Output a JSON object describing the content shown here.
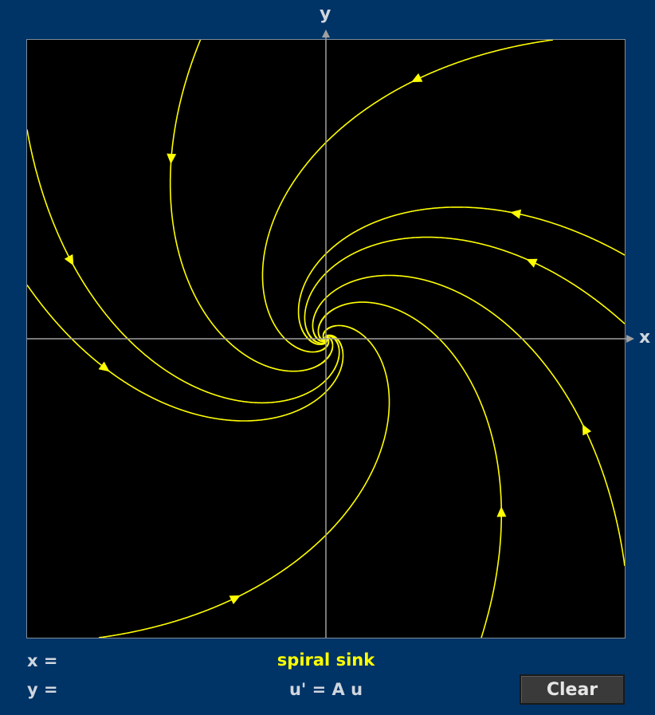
{
  "axes": {
    "x_label": "x",
    "y_label": "y"
  },
  "readouts": {
    "x": "x =",
    "y": "y ="
  },
  "system_type": "spiral sink",
  "equation": "u' = A u",
  "clear_label": "Clear",
  "colors": {
    "background": "#003366",
    "plot": "#000000",
    "trajectory": "#ffff00",
    "axis": "#a0a0a0"
  },
  "chart_data": {
    "type": "line",
    "title": "",
    "xlabel": "x",
    "ylabel": "y",
    "xlim": [
      -1,
      1
    ],
    "ylim": [
      -1,
      1
    ],
    "grid": false,
    "matrix_A": [
      [
        -1,
        -1
      ],
      [
        1,
        -1
      ]
    ],
    "series": [
      {
        "start": [
          -1.0,
          0.7
        ]
      },
      {
        "start": [
          -1.0,
          0.18
        ]
      },
      {
        "start": [
          -0.42,
          1.0
        ]
      },
      {
        "start": [
          -0.76,
          -1.0
        ]
      },
      {
        "start": [
          0.76,
          1.0
        ]
      },
      {
        "start": [
          1.0,
          0.28
        ]
      },
      {
        "start": [
          1.0,
          0.05
        ]
      },
      {
        "start": [
          1.0,
          -0.76
        ]
      },
      {
        "start": [
          0.52,
          -1.0
        ]
      }
    ]
  }
}
